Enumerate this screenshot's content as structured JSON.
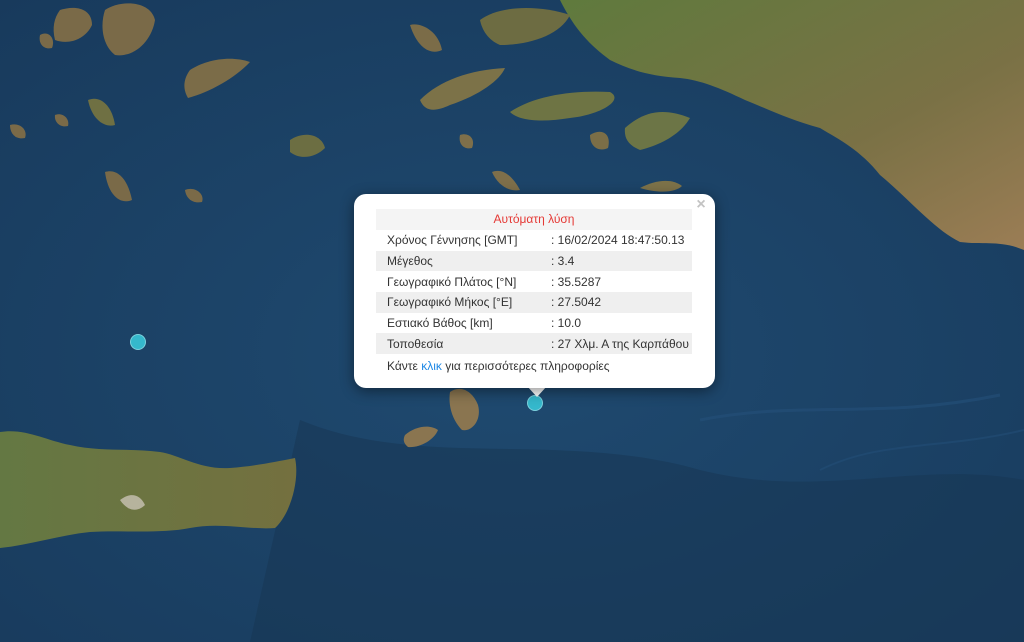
{
  "map": {
    "base_color": "#1d4468",
    "marker_color": "#35b8cc",
    "markers": [
      {
        "id": "quake-west",
        "lat": null,
        "lon": null,
        "selected": false
      },
      {
        "id": "quake-karpathos",
        "lat": 35.5287,
        "lon": 27.5042,
        "selected": true
      }
    ]
  },
  "popup": {
    "title": "Αυτόματη λύση",
    "close_icon": "close-icon",
    "rows": [
      {
        "label": "Χρόνος Γέννησης [GMT]",
        "value": ": 16/02/2024 18:47:50.13"
      },
      {
        "label": "Μέγεθος",
        "value": ": 3.4"
      },
      {
        "label": "Γεωγραφικό Πλάτος [°N]",
        "value": ": 35.5287"
      },
      {
        "label": "Γεωγραφικό Μήκος [°E]",
        "value": ": 27.5042"
      },
      {
        "label": "Εστιακό Βάθος [km]",
        "value": ": 10.0"
      },
      {
        "label": "Τοποθεσία",
        "value": ": 27 Χλμ. Α της Καρπάθου"
      }
    ],
    "more_prefix": "Κάντε ",
    "more_link": "κλικ",
    "more_suffix": " για περισσότερες πληροφορίες",
    "title_color": "#e53935",
    "link_color": "#1e88e5"
  }
}
